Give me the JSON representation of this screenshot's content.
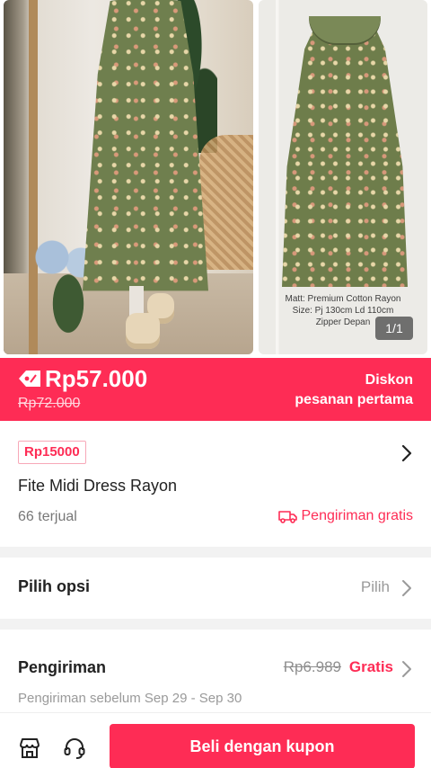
{
  "gallery": {
    "caption_lines": [
      "Matt: Premium Cotton Rayon",
      "Size: Pj 130cm Ld 110cm",
      "Zipper Depan"
    ],
    "counter": "1/1"
  },
  "price": {
    "current": "Rp57.000",
    "original": "Rp72.000",
    "discount_line1": "Diskon",
    "discount_line2": "pesanan pertama",
    "accent_color": "#fe2c55"
  },
  "product": {
    "coupon": "Rp15000",
    "title": "Fite Midi Dress Rayon",
    "sold": "66 terjual",
    "shipping_badge": "Pengiriman gratis"
  },
  "options": {
    "label": "Pilih opsi",
    "value": "Pilih"
  },
  "shipping": {
    "label": "Pengiriman",
    "old_price": "Rp6.989",
    "price": "Gratis",
    "estimate": "Pengiriman sebelum Sep 29 - Sep 30"
  },
  "bottom_bar": {
    "shop_icon": "store-icon",
    "support_icon": "headset-icon",
    "buy_label": "Beli dengan kupon"
  }
}
